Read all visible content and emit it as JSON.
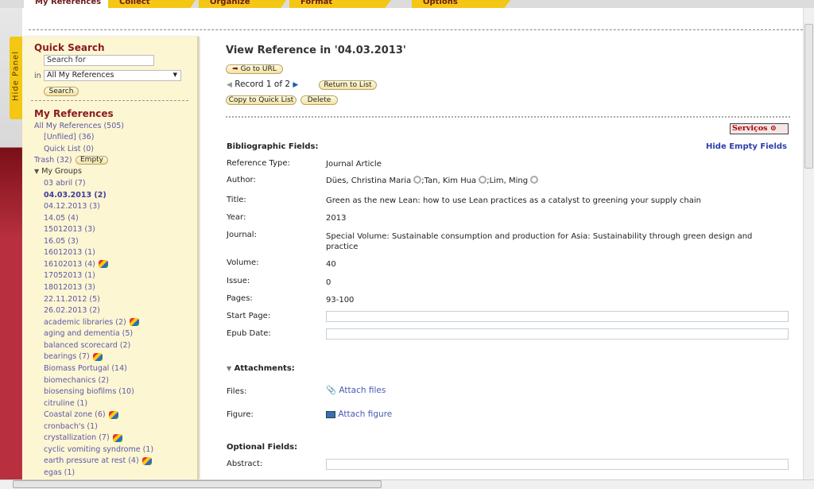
{
  "tabs": [
    "My References",
    "Collect",
    "Organize",
    "Format",
    "Options"
  ],
  "hide_panel": "Hide Panel",
  "quick_search": {
    "title": "Quick Search",
    "placeholder": "Search for",
    "in_label": "in",
    "scope": "All My References",
    "search_button": "Search"
  },
  "my_refs": {
    "title": "My References",
    "all": "All My References (505)",
    "unfiled": "[Unfiled] (36)",
    "quick_list": "Quick List (0)",
    "trash": "Trash (32)",
    "empty_button": "Empty",
    "my_groups": "My Groups"
  },
  "groups": [
    {
      "label": "03 abril (7)"
    },
    {
      "label": "04.03.2013 (2)",
      "selected": true
    },
    {
      "label": "04.12.2013 (3)"
    },
    {
      "label": "14.05 (4)"
    },
    {
      "label": "15012013 (3)"
    },
    {
      "label": "16.05 (3)"
    },
    {
      "label": "16012013 (1)"
    },
    {
      "label": "16102013 (4)",
      "shared": true
    },
    {
      "label": "17052013 (1)"
    },
    {
      "label": "18012013 (3)"
    },
    {
      "label": "22.11.2012 (5)"
    },
    {
      "label": "26.02.2013 (2)"
    },
    {
      "label": "academic libraries (2)",
      "shared": true
    },
    {
      "label": "aging and dementia (5)"
    },
    {
      "label": "balanced scorecard (2)"
    },
    {
      "label": "bearings (7)",
      "shared": true
    },
    {
      "label": "Biomass Portugal (14)"
    },
    {
      "label": "biomechanics (2)"
    },
    {
      "label": "biosensing biofilms (10)"
    },
    {
      "label": "citruline (1)"
    },
    {
      "label": "Coastal zone (6)",
      "shared": true
    },
    {
      "label": "cronbach's (1)"
    },
    {
      "label": "crystallization (7)",
      "shared": true
    },
    {
      "label": "cyclic vomiting syndrome (1)"
    },
    {
      "label": "earth pressure at rest (4)",
      "shared": true
    },
    {
      "label": "egas (1)"
    }
  ],
  "main": {
    "title": "View Reference in '04.03.2013'",
    "go_to_url": "Go to URL",
    "record": "Record 1 of 2",
    "return_to_list": "Return to List",
    "copy_to_quick_list": "Copy to Quick List",
    "delete": "Delete",
    "servicos": "Serviços",
    "biblio_heading": "Bibliographic Fields:",
    "hide_empty": "Hide Empty Fields",
    "fields": {
      "reference_type": {
        "label": "Reference Type:",
        "value": "Journal Article"
      },
      "author": {
        "label": "Author:",
        "authors": [
          "Dües, Christina Maria",
          "Tan, Kim Hua",
          "Lim, Ming"
        ]
      },
      "title": {
        "label": "Title:",
        "value": "Green as the new Lean: how to use Lean practices as a catalyst to greening your supply chain"
      },
      "year": {
        "label": "Year:",
        "value": "2013"
      },
      "journal": {
        "label": "Journal:",
        "value": "Special Volume: Sustainable consumption and production for Asia: Sustainability through green design and practice"
      },
      "volume": {
        "label": "Volume:",
        "value": "40"
      },
      "issue": {
        "label": "Issue:",
        "value": "0"
      },
      "pages": {
        "label": "Pages:",
        "value": "93-100"
      },
      "start_page": {
        "label": "Start Page:",
        "value": ""
      },
      "epub_date": {
        "label": "Epub Date:",
        "value": ""
      }
    },
    "attachments_heading": "Attachments:",
    "files_label": "Files:",
    "attach_files": "Attach files",
    "figure_label": "Figure:",
    "attach_figure": "Attach figure",
    "optional_heading": "Optional Fields:",
    "abstract_label": "Abstract:"
  },
  "colors": {
    "tab": "#f3c713",
    "heading": "#8b1a1a",
    "link": "#5a58a8",
    "panel": "#fdf6d3"
  }
}
